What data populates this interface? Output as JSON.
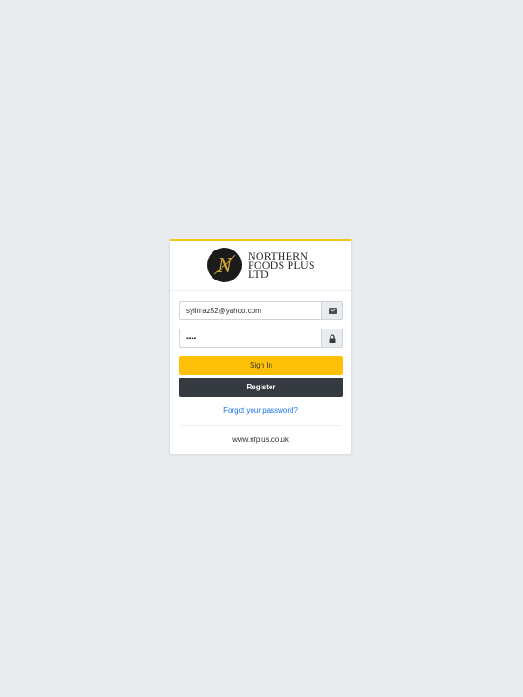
{
  "brand": {
    "logo_letter": "N",
    "name_lines": [
      "NORTHERN",
      "FOODS PLUS",
      "LTD"
    ],
    "accent_color": "#f5c518",
    "logo_gold": "#d4a93a"
  },
  "login_form": {
    "email_value": "syilmaz52@yahoo.com",
    "email_icon": "envelope-icon",
    "password_value": "••••",
    "password_icon": "lock-icon",
    "signin_label": "Sign In",
    "register_label": "Register",
    "forgot_label": "Forgot your password?"
  },
  "footer": {
    "website": "www.nfplus.co.uk"
  },
  "colors": {
    "background": "#e9ecef",
    "signin_button": "#ffc107",
    "register_button": "#343a40",
    "link": "#1a73e8"
  }
}
